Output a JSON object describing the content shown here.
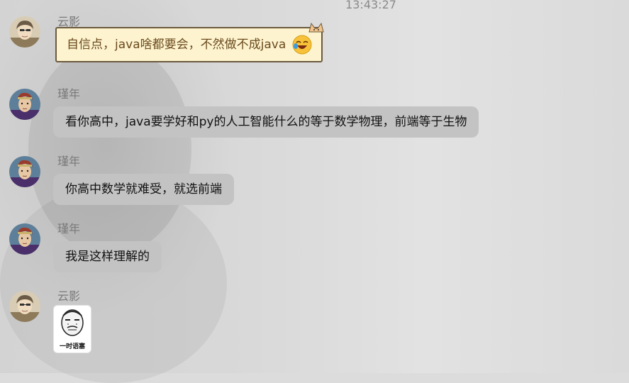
{
  "chat": {
    "timestamp": "13:43:27",
    "messages": [
      {
        "sender": "云影",
        "text": "自信点，java啥都要会，不然做不成java",
        "style": "fancy-bubble",
        "trailing_icon": "laughing-emoji-icon"
      },
      {
        "sender": "瑾年",
        "text": "看你高中，java要学好和py的人工智能什么的等于数学物理，前端等于生物"
      },
      {
        "sender": "瑾年",
        "text": "你高中数学就难受，就选前端"
      },
      {
        "sender": "瑾年",
        "text": "我是这样理解的"
      },
      {
        "sender": "云影",
        "sticker_caption": "一时语塞"
      }
    ]
  },
  "colors": {
    "background": "#dcdcdc",
    "bubble_gray": "#c3c3c3",
    "fancy_bubble_fill": "#fdf4cf",
    "fancy_bubble_border": "#6b5a3e",
    "fancy_text": "#6b4a1f",
    "sender_name": "#7a7a7a",
    "timestamp": "#8a8a8a"
  }
}
